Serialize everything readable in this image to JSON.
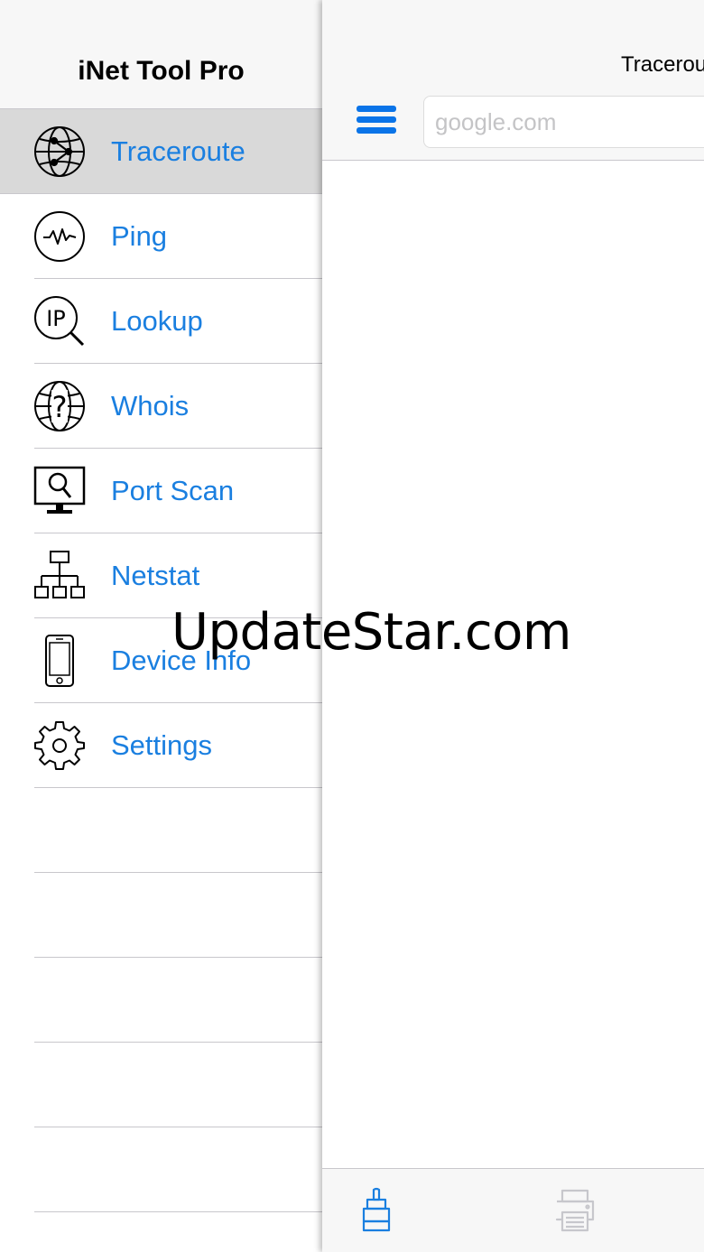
{
  "sidebar": {
    "title": "iNet Tool Pro",
    "items": [
      {
        "label": "Traceroute",
        "icon": "traceroute-globe-icon",
        "selected": true
      },
      {
        "label": "Ping",
        "icon": "ping-pulse-icon",
        "selected": false
      },
      {
        "label": "Lookup",
        "icon": "ip-lookup-icon",
        "selected": false
      },
      {
        "label": "Whois",
        "icon": "whois-globe-icon",
        "selected": false
      },
      {
        "label": "Port Scan",
        "icon": "port-scan-monitor-icon",
        "selected": false
      },
      {
        "label": "Netstat",
        "icon": "netstat-network-icon",
        "selected": false
      },
      {
        "label": "Device Info",
        "icon": "device-phone-icon",
        "selected": false
      },
      {
        "label": "Settings",
        "icon": "gear-icon",
        "selected": false
      }
    ]
  },
  "main": {
    "title": "Tracerou",
    "search": {
      "placeholder": "google.com",
      "value": ""
    },
    "toolbar": {
      "clear_icon": "brush-icon",
      "print_icon": "printer-icon"
    }
  },
  "watermark": "UpdateStar.com",
  "colors": {
    "accent": "#1a7fe0",
    "selected_row": "#d9d9d9",
    "bar_background": "#f7f7f7",
    "separator": "#c8c7cc"
  }
}
